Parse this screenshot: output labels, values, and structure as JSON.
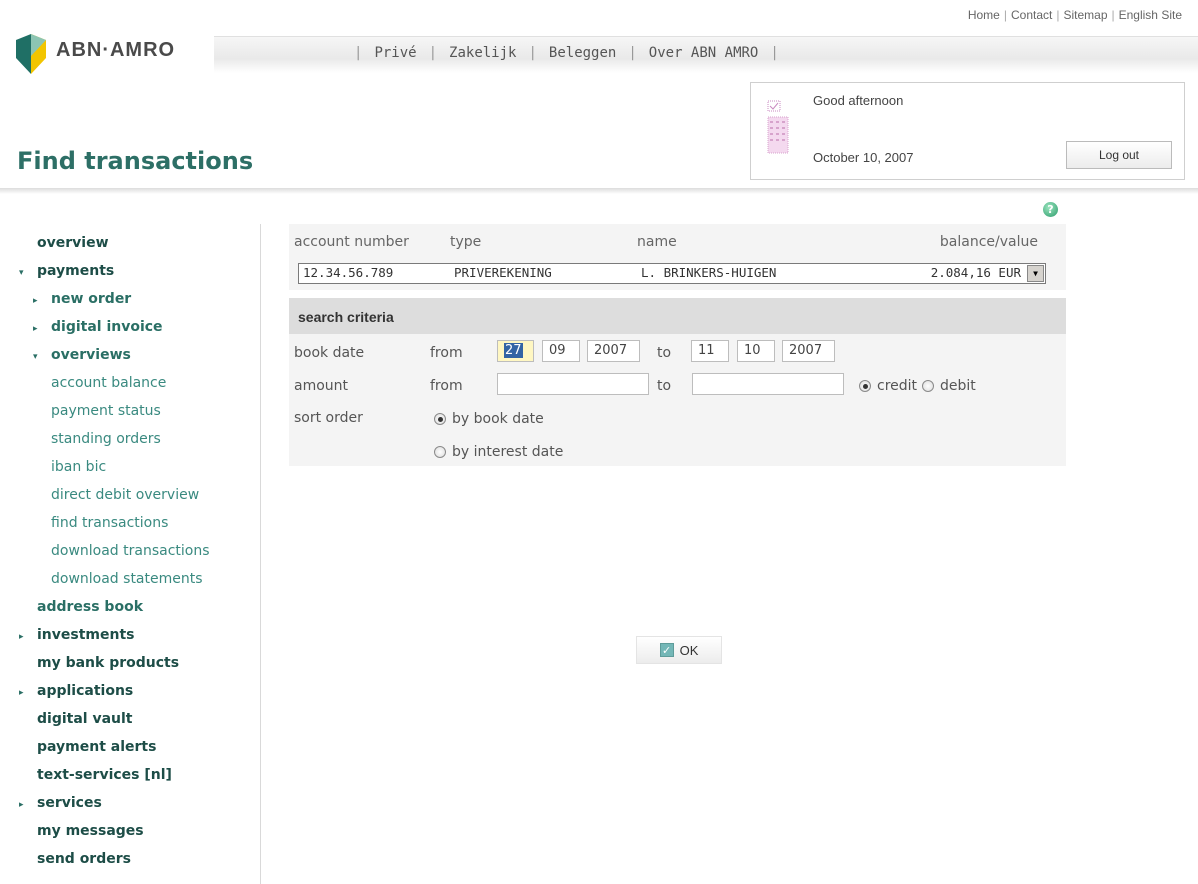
{
  "utility_links": [
    "Home",
    "Contact",
    "Sitemap",
    "English Site"
  ],
  "logo_text": "ABN·AMRO",
  "nav": [
    "Privé",
    "Zakelijk",
    "Beleggen",
    "Over ABN AMRO"
  ],
  "page_title": "Find transactions",
  "greeting": {
    "text": "Good afternoon",
    "date": "October 10, 2007",
    "logout_label": "Log out"
  },
  "sidebar": [
    {
      "label": "overview",
      "level": 1,
      "arrow": ""
    },
    {
      "label": "payments",
      "level": 1,
      "arrow": "down"
    },
    {
      "label": "new order",
      "level": 2,
      "arrow": "right"
    },
    {
      "label": "digital invoice",
      "level": 2,
      "arrow": "right"
    },
    {
      "label": "overviews",
      "level": 2,
      "arrow": "down"
    },
    {
      "label": "account balance",
      "level": 3,
      "arrow": ""
    },
    {
      "label": "payment status",
      "level": 3,
      "arrow": ""
    },
    {
      "label": "standing orders",
      "level": 3,
      "arrow": ""
    },
    {
      "label": "iban bic",
      "level": 3,
      "arrow": ""
    },
    {
      "label": "direct debit overview",
      "level": 3,
      "arrow": ""
    },
    {
      "label": "find transactions",
      "level": 3,
      "arrow": ""
    },
    {
      "label": "download transactions",
      "level": 3,
      "arrow": ""
    },
    {
      "label": "download statements",
      "level": 3,
      "arrow": ""
    },
    {
      "label": "address book",
      "level": 2,
      "arrow": ""
    },
    {
      "label": "investments",
      "level": 1,
      "arrow": "right"
    },
    {
      "label": "my bank products",
      "level": 1,
      "arrow": ""
    },
    {
      "label": "applications",
      "level": 1,
      "arrow": "right"
    },
    {
      "label": "digital vault",
      "level": 1,
      "arrow": ""
    },
    {
      "label": "payment alerts",
      "level": 1,
      "arrow": ""
    },
    {
      "label": "text-services [nl]",
      "level": 1,
      "arrow": ""
    },
    {
      "label": "services",
      "level": 1,
      "arrow": "right"
    },
    {
      "label": "my messages",
      "level": 1,
      "arrow": ""
    },
    {
      "label": "send orders",
      "level": 1,
      "arrow": ""
    }
  ],
  "account": {
    "headers": {
      "number": "account number",
      "type": "type",
      "name": "name",
      "balance": "balance/value"
    },
    "number": "12.34.56.789",
    "type": "PRIVEREKENING",
    "name": "L. BRINKERS-HUIGEN",
    "balance": "2.084,16 EUR"
  },
  "search": {
    "title": "search criteria",
    "book_date_label": "book date",
    "from_label": "from",
    "to_label": "to",
    "from_day": "27",
    "from_month": "09",
    "from_year": "2007",
    "to_day": "11",
    "to_month": "10",
    "to_year": "2007",
    "amount_label": "amount",
    "amount_from": "",
    "amount_to": "",
    "credit_label": "credit",
    "debit_label": "debit",
    "credit_selected": true,
    "sort_order_label": "sort order",
    "by_book_date_label": "by book date",
    "by_interest_date_label": "by interest date",
    "sort_selected": "book_date"
  },
  "ok_label": "OK",
  "help_glyph": "?",
  "colors": {
    "brand_green": "#2d6f66",
    "brand_yellow": "#f2c500",
    "accent_teal": "#3a8a80"
  }
}
